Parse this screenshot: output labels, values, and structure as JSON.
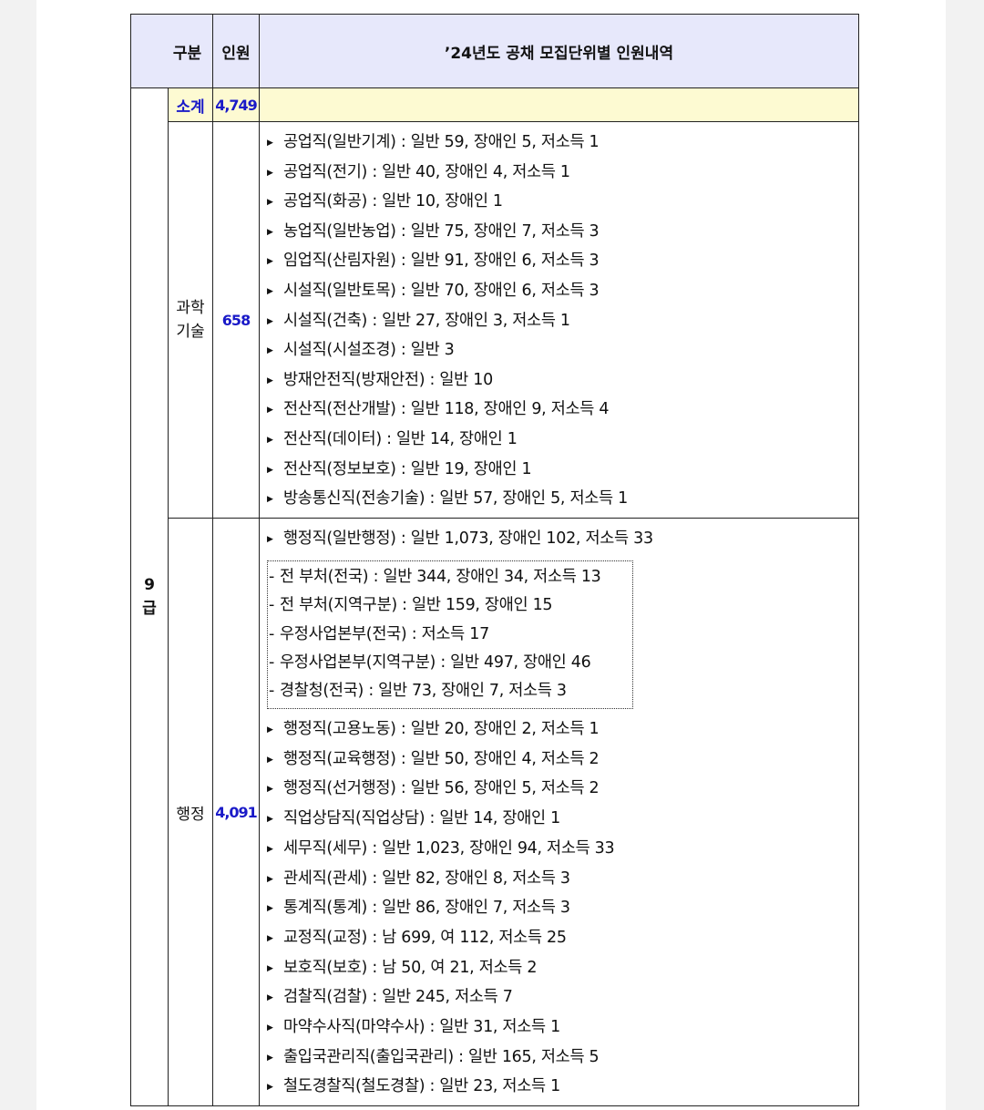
{
  "header": {
    "col_gubun": "구분",
    "col_inwon": "인원",
    "col_detail": "’24년도 공채 모집단위별 인원내역"
  },
  "grade": {
    "label_line1": "9",
    "label_line2": "급"
  },
  "subtotal": {
    "label": "소계",
    "value": "4,749"
  },
  "science": {
    "label_line1": "과학",
    "label_line2": "기술",
    "count": "658",
    "items": [
      "공업직(일반기계) : 일반 59, 장애인 5, 저소득 1",
      "공업직(전기) : 일반 40, 장애인 4, 저소득 1",
      "공업직(화공) : 일반 10, 장애인 1",
      "농업직(일반농업) : 일반 75, 장애인 7, 저소득 3",
      "임업직(산림자원) : 일반 91, 장애인 6, 저소득 3",
      "시설직(일반토목) : 일반 70, 장애인 6, 저소득 3",
      "시설직(건축) : 일반 27, 장애인 3, 저소득 1",
      "시설직(시설조경) : 일반 3",
      "방재안전직(방재안전) : 일반 10",
      "전산직(전산개발) : 일반 118, 장애인 9, 저소득 4",
      "전산직(데이터) : 일반 14, 장애인 1",
      "전산직(정보보호) : 일반 19, 장애인 1",
      "방송통신직(전송기술) : 일반 57, 장애인 5, 저소득 1"
    ]
  },
  "admin": {
    "label": "행정",
    "count": "4,091",
    "first_item": "행정직(일반행정) : 일반 1,073, 장애인 102, 저소득 33",
    "sub_items": [
      "전 부처(전국) : 일반 344, 장애인 34, 저소득 13",
      "전 부처(지역구분) : 일반 159, 장애인 15",
      "우정사업본부(전국) : 저소득 17",
      "우정사업본부(지역구분) : 일반 497, 장애인 46",
      "경찰청(전국) : 일반 73, 장애인 7, 저소득 3"
    ],
    "items": [
      "행정직(고용노동) : 일반 20, 장애인 2, 저소득 1",
      "행정직(교육행정) : 일반 50, 장애인 4, 저소득 2",
      "행정직(선거행정) : 일반 56, 장애인 5, 저소득 2",
      "직업상담직(직업상담) : 일반 14, 장애인 1",
      "세무직(세무) : 일반 1,023, 장애인 94, 저소득 33",
      "관세직(관세) : 일반 82, 장애인 8, 저소득 3",
      "통계직(통계) : 일반 86, 장애인 7, 저소득 3",
      "교정직(교정) : 남 699, 여 112, 저소득 25",
      "보호직(보호) : 남 50, 여 21, 저소득 2",
      "검찰직(검찰) : 일반 245, 저소득 7",
      "마약수사직(마약수사) : 일반 31, 저소득 1",
      "출입국관리직(출입국관리) : 일반 165, 저소득 5",
      "철도경찰직(철도경찰) : 일반 23, 저소득 1"
    ]
  }
}
